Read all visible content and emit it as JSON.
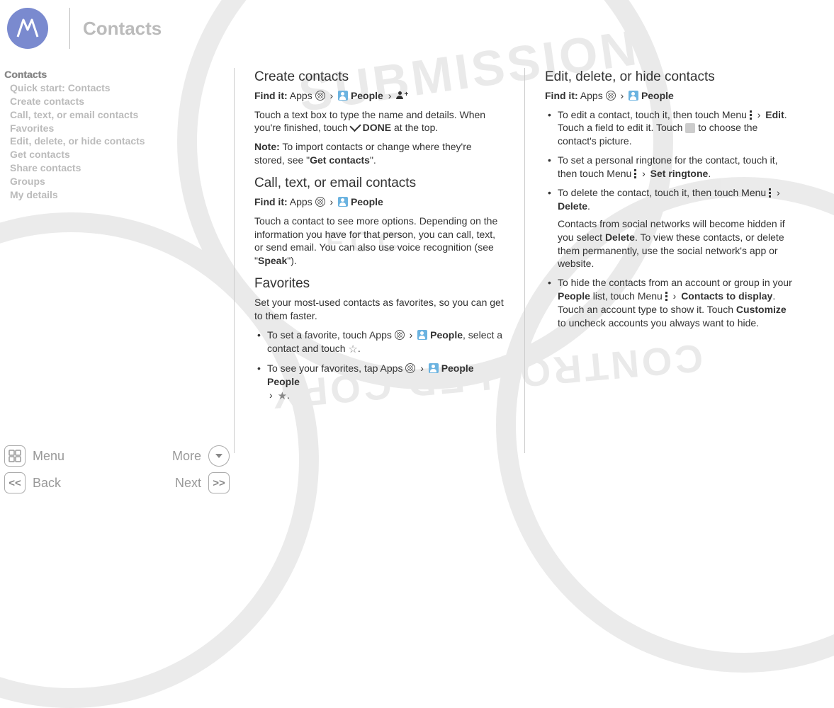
{
  "header": {
    "title": "Contacts"
  },
  "toc": {
    "head": "Contacts",
    "items": [
      "Quick start: Contacts",
      "Create contacts",
      "Call, text, or email contacts",
      "Favorites",
      "Edit, delete, or hide contacts",
      "Get contacts",
      "Share contacts",
      "Groups",
      "My details"
    ]
  },
  "col1": {
    "h_create": "Create contacts",
    "create_findit_label": "Find it:",
    "create_findit_apps": "Apps",
    "create_findit_people": "People",
    "create_p1a": "Touch a text box to type the name and details. When you're finished, touch ",
    "create_p1_done": "DONE",
    "create_p1b": " at the top.",
    "create_note_label": "Note:",
    "create_note_a": " To import contacts or change where they're stored, see \"",
    "create_note_link": "Get contacts",
    "create_note_b": "\".",
    "h_call": "Call, text, or email contacts",
    "call_findit_label": "Find it:",
    "call_findit_apps": "Apps",
    "call_findit_people": "People",
    "call_p1a": "Touch a contact to see more options. Depending on the information you have for that person, you can call, text, or send email. You can also use voice recognition (see \"",
    "call_p1_link": "Speak",
    "call_p1b": "\").",
    "h_fav": "Favorites",
    "fav_p1": "Set your most-used contacts as favorites, so you can get to them faster.",
    "fav_b1a": "To set a favorite, touch Apps ",
    "fav_b1_people": "People",
    "fav_b1b": ", select a contact and touch ",
    "fav_b1c": ".",
    "fav_b2a": "To see your favorites, tap Apps ",
    "fav_b2_people": "People People",
    "fav_b2c": "."
  },
  "col2": {
    "h_edit": "Edit, delete, or hide contacts",
    "edit_findit_label": "Find it:",
    "edit_findit_apps": "Apps",
    "edit_findit_people": "People",
    "b1a": "To edit a contact, touch it, then touch Menu ",
    "b1_edit": "Edit",
    "b1b": ". Touch a field to edit it. Touch ",
    "b1c": " to choose the contact's picture.",
    "b2a": "To set a personal ringtone for the contact, touch it, then touch Menu ",
    "b2_ring": "Set ringtone",
    "b2b": ".",
    "b3a": "To delete the contact, touch it, then touch Menu ",
    "b3_del": "Delete",
    "b3b": ".",
    "b3_sub_a": "Contacts from social networks will become hidden if you select ",
    "b3_sub_del": "Delete",
    "b3_sub_b": ". To view these contacts, or delete them permanently, use the social network's app or website.",
    "b4a": "To hide the contacts from an account or group in your ",
    "b4_people": "People",
    "b4b": " list, touch Menu ",
    "b4_ctd": "Contacts to display",
    "b4c": ". Touch an account type to show it. Touch ",
    "b4_cust": "Customize",
    "b4d": " to uncheck accounts you always want to hide."
  },
  "nav": {
    "menu": "Menu",
    "more": "More",
    "back": "Back",
    "next": "Next",
    "prev_sym": "<<",
    "next_sym": ">>"
  }
}
